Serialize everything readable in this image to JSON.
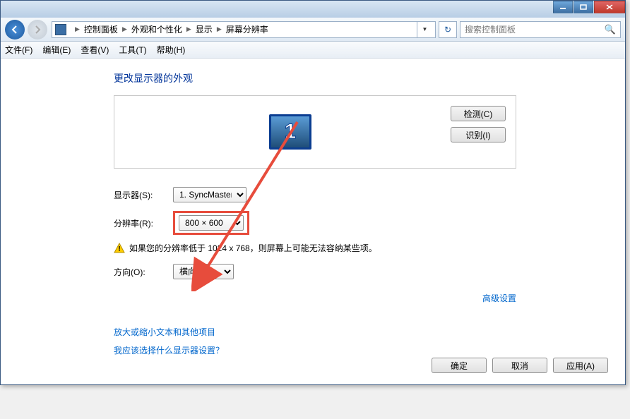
{
  "breadcrumb": {
    "cp": "控制面板",
    "appearance": "外观和个性化",
    "display": "显示",
    "resolution": "屏幕分辨率"
  },
  "search": {
    "placeholder": "搜索控制面板"
  },
  "menu": {
    "file": "文件(F)",
    "edit": "编辑(E)",
    "view": "查看(V)",
    "tools": "工具(T)",
    "help": "帮助(H)"
  },
  "heading": "更改显示器的外观",
  "monitor_number": "1",
  "panel_buttons": {
    "detect": "检测(C)",
    "identify": "识别(I)"
  },
  "labels": {
    "display": "显示器(S):",
    "resolution": "分辨率(R):",
    "orientation": "方向(O):"
  },
  "values": {
    "display_selected": "1. SyncMaster",
    "resolution_selected": "800 × 600",
    "orientation_selected": "横向"
  },
  "warning": "如果您的分辨率低于 1024 x 768，则屏幕上可能无法容纳某些项。",
  "links": {
    "advanced": "高级设置",
    "scale": "放大或缩小文本和其他项目",
    "which": "我应该选择什么显示器设置？"
  },
  "buttons": {
    "ok": "确定",
    "cancel": "取消",
    "apply": "应用(A)"
  }
}
